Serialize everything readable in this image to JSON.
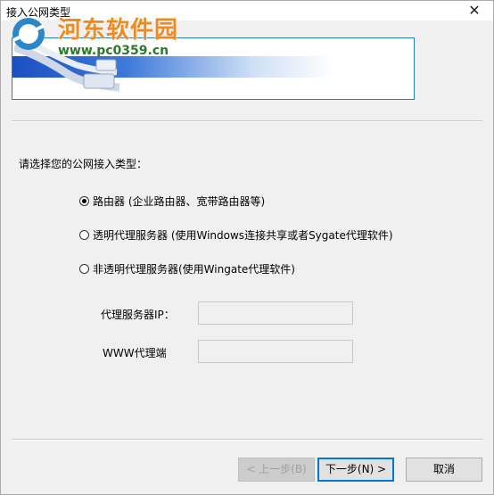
{
  "window": {
    "title": "接入公网类型",
    "close_glyph": "✕"
  },
  "banner": {
    "watermark_name": "河东软件园",
    "watermark_url": "www.pc0359.cn"
  },
  "main": {
    "prompt": "请选择您的公网接入类型：",
    "options": [
      {
        "label": "路由器 (企业路由器、宽带路由器等)",
        "checked": true
      },
      {
        "label": "透明代理服务器 (使用Windows连接共享或者Sygate代理软件)",
        "checked": false
      },
      {
        "label": "非透明代理服务器(使用Wingate代理软件)",
        "checked": false
      }
    ],
    "proxy_ip_label": "代理服务器IP：",
    "proxy_ip_value": "",
    "www_port_label": "WWW代理端",
    "www_port_value": ""
  },
  "buttons": {
    "back": "< 上一步(B)",
    "next": "下一步(N) >",
    "cancel": "取消"
  }
}
